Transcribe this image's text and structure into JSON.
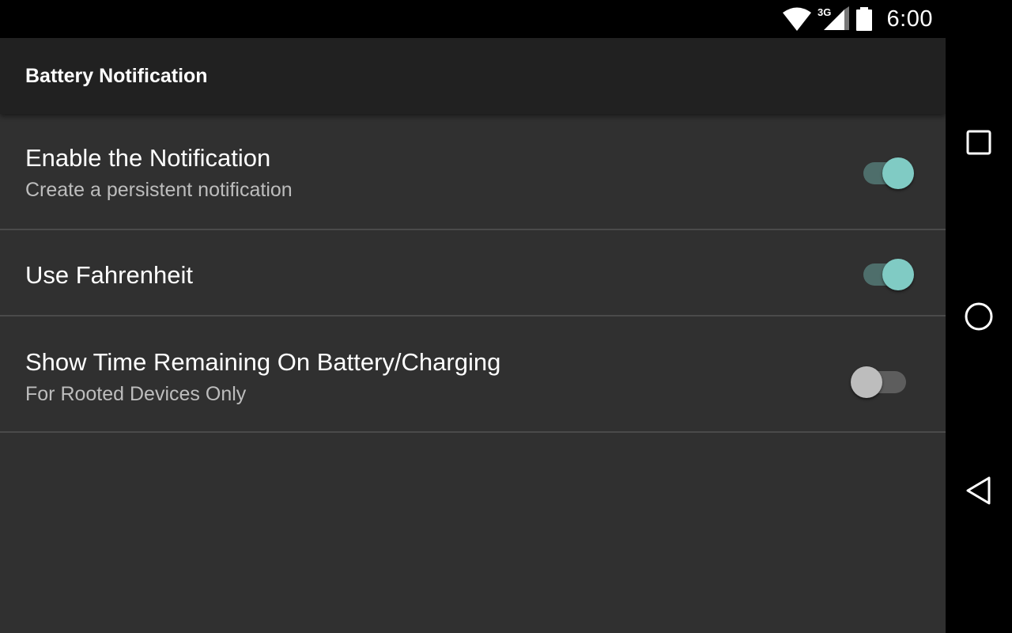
{
  "status_bar": {
    "time": "6:00",
    "network_type": "3G",
    "icons": [
      "wifi-icon",
      "cellular-signal-icon",
      "battery-icon"
    ]
  },
  "toolbar": {
    "title": "Battery Notification"
  },
  "preferences": [
    {
      "title": "Enable the Notification",
      "summary": "Create a persistent notification",
      "enabled": true
    },
    {
      "title": "Use Fahrenheit",
      "summary": "",
      "enabled": true
    },
    {
      "title": "Show Time Remaining On Battery/Charging",
      "summary": "For Rooted Devices Only",
      "enabled": false
    }
  ],
  "nav_bar": {
    "buttons": [
      "recents-icon",
      "home-icon",
      "back-icon"
    ]
  },
  "colors": {
    "accent": "#80cbc4",
    "background": "#303030",
    "toolbar": "#212121"
  }
}
